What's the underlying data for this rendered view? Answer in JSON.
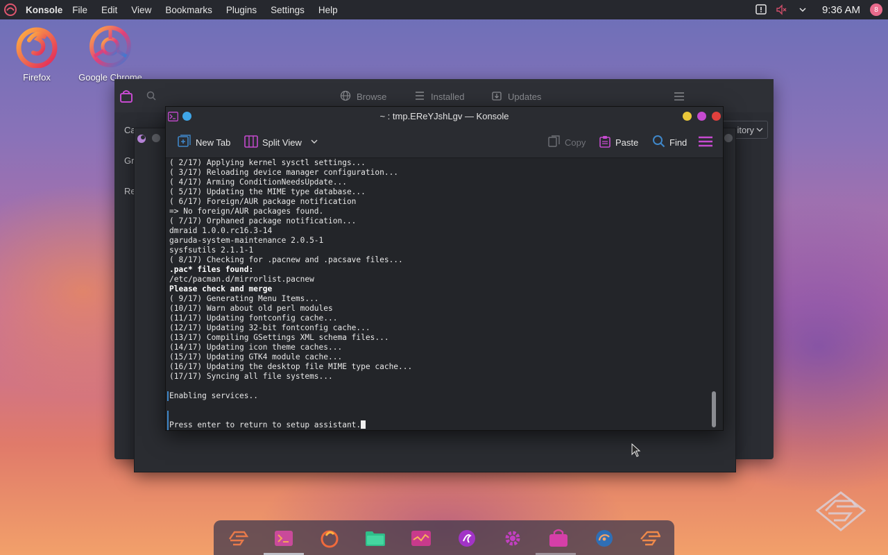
{
  "top_panel": {
    "app_name": "Konsole",
    "menu": [
      "File",
      "Edit",
      "View",
      "Bookmarks",
      "Plugins",
      "Settings",
      "Help"
    ],
    "clock": "9:36 AM",
    "avatar_initial": "8"
  },
  "desktop_icons": [
    {
      "label": "Firefox",
      "icon": "firefox-icon"
    },
    {
      "label": "Google Chrome",
      "icon": "chrome-icon"
    }
  ],
  "bg_window": {
    "tabs": [
      "Browse",
      "Installed",
      "Updates"
    ],
    "sidebar_items": [
      "Ca",
      "Gr",
      "Re"
    ],
    "repo_button": "itory"
  },
  "konsole": {
    "title": "~ : tmp.EReYJshLgv — Konsole",
    "toolbar": {
      "new_tab": "New Tab",
      "split_view": "Split View",
      "copy": "Copy",
      "paste": "Paste",
      "find": "Find"
    },
    "lines": [
      {
        "text": "( 2/17) Applying kernel sysctl settings...",
        "bold": false
      },
      {
        "text": "( 3/17) Reloading device manager configuration...",
        "bold": false
      },
      {
        "text": "( 4/17) Arming ConditionNeedsUpdate...",
        "bold": false
      },
      {
        "text": "( 5/17) Updating the MIME type database...",
        "bold": false
      },
      {
        "text": "( 6/17) Foreign/AUR package notification",
        "bold": false
      },
      {
        "text": "=> No foreign/AUR packages found.",
        "bold": false
      },
      {
        "text": "( 7/17) Orphaned package notification...",
        "bold": false
      },
      {
        "text": "dmraid 1.0.0.rc16.3-14",
        "bold": false
      },
      {
        "text": "garuda-system-maintenance 2.0.5-1",
        "bold": false
      },
      {
        "text": "sysfsutils 2.1.1-1",
        "bold": false
      },
      {
        "text": "( 8/17) Checking for .pacnew and .pacsave files...",
        "bold": false
      },
      {
        "text": ".pac* files found:",
        "bold": true
      },
      {
        "text": "/etc/pacman.d/mirrorlist.pacnew",
        "bold": false
      },
      {
        "text": "Please check and merge",
        "bold": true
      },
      {
        "text": "( 9/17) Generating Menu Items...",
        "bold": false
      },
      {
        "text": "(10/17) Warn about old perl modules",
        "bold": false
      },
      {
        "text": "(11/17) Updating fontconfig cache...",
        "bold": false
      },
      {
        "text": "(12/17) Updating 32-bit fontconfig cache...",
        "bold": false
      },
      {
        "text": "(13/17) Compiling GSettings XML schema files...",
        "bold": false
      },
      {
        "text": "(14/17) Updating icon theme caches...",
        "bold": false
      },
      {
        "text": "(15/17) Updating GTK4 module cache...",
        "bold": false
      },
      {
        "text": "(16/17) Updating the desktop file MIME type cache...",
        "bold": false
      },
      {
        "text": "(17/17) Syncing all file systems...",
        "bold": false
      },
      {
        "text": "",
        "bold": false
      },
      {
        "text": "Enabling services..",
        "bold": false
      },
      {
        "text": "",
        "bold": false
      },
      {
        "text": "",
        "bold": false
      },
      {
        "text": "Press enter to return to setup assistant.",
        "bold": false
      }
    ]
  },
  "dock": {
    "items": [
      "garuda-welcome-icon",
      "konsole-icon",
      "firefox-icon",
      "files-icon",
      "system-monitor-icon",
      "garuda-settings-icon",
      "gear-icon",
      "discover-icon",
      "network-icon",
      "garuda-assistant-icon"
    ]
  },
  "colors": {
    "accent": "#3f87c9",
    "panel": "#26282e",
    "terminal_bg": "#232529",
    "close": "#e2403d",
    "minimize": "#e9c73a",
    "maximize": "#c64ad0"
  }
}
